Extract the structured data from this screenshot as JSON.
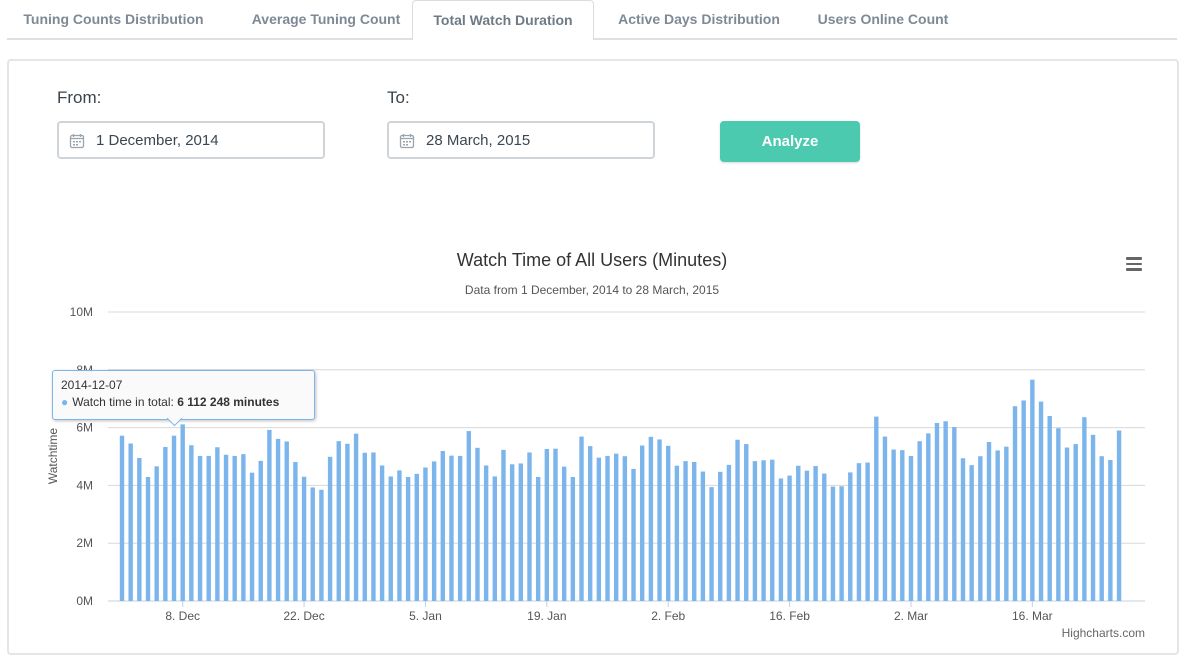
{
  "tabs": [
    {
      "label": "Tuning Counts Distribution",
      "active": false
    },
    {
      "label": "Average Tuning Count",
      "active": false
    },
    {
      "label": "Total Watch Duration",
      "active": true
    },
    {
      "label": "Active Days Distribution",
      "active": false
    },
    {
      "label": "Users Online Count",
      "active": false
    }
  ],
  "form": {
    "from_label": "From:",
    "from_value": "1 December, 2014",
    "to_label": "To:",
    "to_value": "28 March, 2015",
    "analyze_label": "Analyze"
  },
  "tooltip": {
    "date": "2014-12-07",
    "series": "Watch time in total: ",
    "value": "6 112 248 minutes"
  },
  "credits": "Highcharts.com",
  "colors": {
    "bar": "#7cb5ec",
    "button": "#4ccab0",
    "grid": "#d8d8d8"
  },
  "chart_data": {
    "type": "bar",
    "title": "Watch Time of All Users (Minutes)",
    "subtitle": "Data from 1 December, 2014 to 28 March, 2015",
    "ylabel": "Watchtime",
    "ylim": [
      0,
      10000000
    ],
    "y_ticks": [
      "0M",
      "2M",
      "4M",
      "6M",
      "8M",
      "10M"
    ],
    "x_ticks": [
      {
        "label": "8. Dec",
        "date": "2014-12-08"
      },
      {
        "label": "22. Dec",
        "date": "2014-12-22"
      },
      {
        "label": "5. Jan",
        "date": "2015-01-05"
      },
      {
        "label": "19. Jan",
        "date": "2015-01-19"
      },
      {
        "label": "2. Feb",
        "date": "2015-02-02"
      },
      {
        "label": "16. Feb",
        "date": "2015-02-16"
      },
      {
        "label": "2. Mar",
        "date": "2015-03-02"
      },
      {
        "label": "16. Mar",
        "date": "2015-03-16"
      }
    ],
    "x_start": "2014-12-01",
    "values": [
      5720000,
      5450000,
      4950000,
      4290000,
      4660000,
      5330000,
      5720000,
      6112248,
      5390000,
      5020000,
      5020000,
      5320000,
      5060000,
      5020000,
      5080000,
      4440000,
      4850000,
      5920000,
      5610000,
      5520000,
      4810000,
      4300000,
      3930000,
      3850000,
      4990000,
      5530000,
      5440000,
      5790000,
      5130000,
      5140000,
      4690000,
      4310000,
      4520000,
      4290000,
      4400000,
      4620000,
      4830000,
      5190000,
      5030000,
      5020000,
      5880000,
      5300000,
      4690000,
      4310000,
      5230000,
      4730000,
      4760000,
      5140000,
      4290000,
      5260000,
      5270000,
      4650000,
      4290000,
      5690000,
      5360000,
      4960000,
      5020000,
      5100000,
      5010000,
      4570000,
      5380000,
      5680000,
      5590000,
      5370000,
      4680000,
      4840000,
      4810000,
      4480000,
      3940000,
      4470000,
      4710000,
      5580000,
      5430000,
      4840000,
      4870000,
      4890000,
      4240000,
      4340000,
      4680000,
      4510000,
      4670000,
      4410000,
      3960000,
      3970000,
      4450000,
      4770000,
      4790000,
      6380000,
      5690000,
      5240000,
      5220000,
      5020000,
      5530000,
      5800000,
      6160000,
      6220000,
      6020000,
      4940000,
      4700000,
      5010000,
      5500000,
      5210000,
      5340000,
      6740000,
      6940000,
      7660000,
      6900000,
      6400000,
      5980000,
      5310000,
      5430000,
      6360000,
      5750000,
      5010000,
      4880000,
      5900000
    ]
  }
}
